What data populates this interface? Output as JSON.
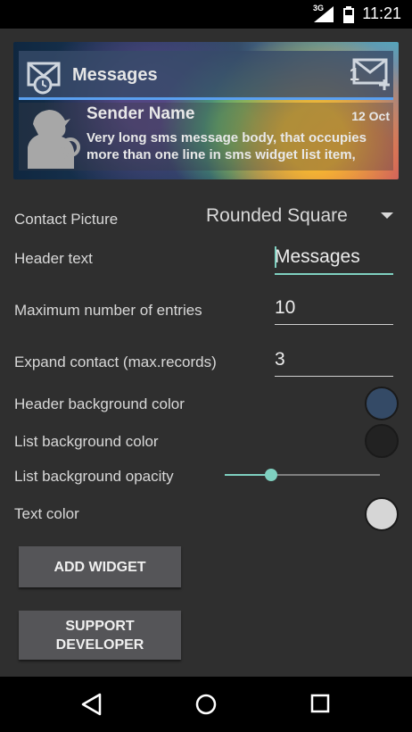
{
  "status_bar": {
    "time": "11:21",
    "network": "3G"
  },
  "preview": {
    "header_title": "Messages",
    "unread_count": "1",
    "sender": "Sender Name",
    "date": "12 Oct",
    "body": "Very long sms message body, that occupies more than one line in sms widget list item,"
  },
  "settings": {
    "contact_picture": {
      "label": "Contact Picture",
      "value": "Rounded Square"
    },
    "header_text": {
      "label": "Header text",
      "value": "Messages"
    },
    "max_entries": {
      "label": "Maximum number of entries",
      "value": "10"
    },
    "expand_contact": {
      "label": "Expand contact (max.records)",
      "value": "3"
    },
    "header_bg_color": {
      "label": "Header background color",
      "color": "#344a66"
    },
    "list_bg_color": {
      "label": "List background color",
      "color": "#222222"
    },
    "list_bg_opacity": {
      "label": "List background opacity",
      "level": 0.3
    },
    "text_color": {
      "label": "Text color",
      "color": "#d6d6d6"
    }
  },
  "buttons": {
    "add_widget": "ADD WIDGET",
    "support_developer": "SUPPORT DEVELOPER"
  },
  "accent_color": "#7fd0c0"
}
